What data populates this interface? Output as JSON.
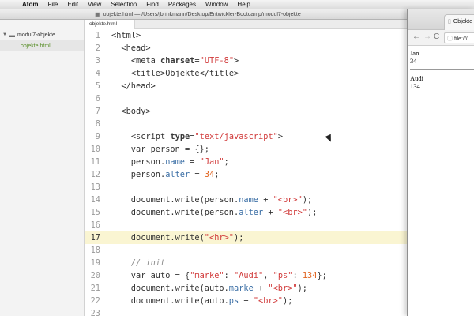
{
  "menubar": {
    "apple_icon": "apple-icon",
    "items": [
      "Atom",
      "File",
      "Edit",
      "View",
      "Selection",
      "Find",
      "Packages",
      "Window",
      "Help"
    ]
  },
  "atom": {
    "title": "objekte.html — /Users/jbrinkmann/Desktop/Entwickler-Bootcamp/modul7-objekte",
    "sidebar": {
      "project": "modul7-objekte",
      "file": "objekte.html"
    },
    "tab_label": "objekte.html",
    "active_line": 17,
    "code_lines": [
      {
        "n": "1",
        "html": "<span class='t-tag'>&lt;html&gt;</span>"
      },
      {
        "n": "2",
        "html": "  <span class='t-tag'>&lt;head&gt;</span>"
      },
      {
        "n": "3",
        "html": "    <span class='t-tag'>&lt;meta</span> <span class='t-attr'>charset</span>=<span class='t-str'>\"UTF-8\"</span><span class='t-tag'>&gt;</span>"
      },
      {
        "n": "4",
        "html": "    <span class='t-tag'>&lt;title&gt;</span>Objekte<span class='t-tag'>&lt;/title&gt;</span>"
      },
      {
        "n": "5",
        "html": "  <span class='t-tag'>&lt;/head&gt;</span>"
      },
      {
        "n": "6",
        "html": ""
      },
      {
        "n": "7",
        "html": "  <span class='t-tag'>&lt;body&gt;</span>"
      },
      {
        "n": "8",
        "html": ""
      },
      {
        "n": "9",
        "html": "    <span class='t-tag'>&lt;script</span> <span class='t-attr'>type</span>=<span class='t-str'>\"text/javascript\"</span><span class='t-tag'>&gt;</span>"
      },
      {
        "n": "10",
        "html": "    var person = {};"
      },
      {
        "n": "11",
        "html": "    person.<span class='t-prop'>name</span> = <span class='t-str'>\"Jan\"</span>;"
      },
      {
        "n": "12",
        "html": "    person.<span class='t-prop'>alter</span> = <span class='t-num'>34</span>;"
      },
      {
        "n": "13",
        "html": ""
      },
      {
        "n": "14",
        "html": "    document.write(person.<span class='t-prop'>name</span> + <span class='t-str'>\"&lt;br&gt;\"</span>);"
      },
      {
        "n": "15",
        "html": "    document.write(person.<span class='t-prop'>alter</span> + <span class='t-str'>\"&lt;br&gt;\"</span>);"
      },
      {
        "n": "16",
        "html": ""
      },
      {
        "n": "17",
        "html": "    document.write(<span class='t-str'>\"&lt;hr&gt;\"</span>);"
      },
      {
        "n": "18",
        "html": ""
      },
      {
        "n": "19",
        "html": "    <span class='t-cmt'>// init</span>"
      },
      {
        "n": "20",
        "html": "    var auto = {<span class='t-str'>\"marke\"</span>: <span class='t-str'>\"Audi\"</span>, <span class='t-str'>\"ps\"</span>: <span class='t-num'>134</span>};"
      },
      {
        "n": "21",
        "html": "    document.write(auto.<span class='t-prop'>marke</span> + <span class='t-str'>\"&lt;br&gt;\"</span>);"
      },
      {
        "n": "22",
        "html": "    document.write(auto.<span class='t-prop'>ps</span> + <span class='t-str'>\"&lt;br&gt;\"</span>);"
      },
      {
        "n": "23",
        "html": ""
      }
    ]
  },
  "browser": {
    "tab_title": "Objekte",
    "url": "file:///",
    "output": {
      "person_name": "Jan",
      "person_alter": "34",
      "auto_marke": "Audi",
      "auto_ps": "134"
    }
  }
}
